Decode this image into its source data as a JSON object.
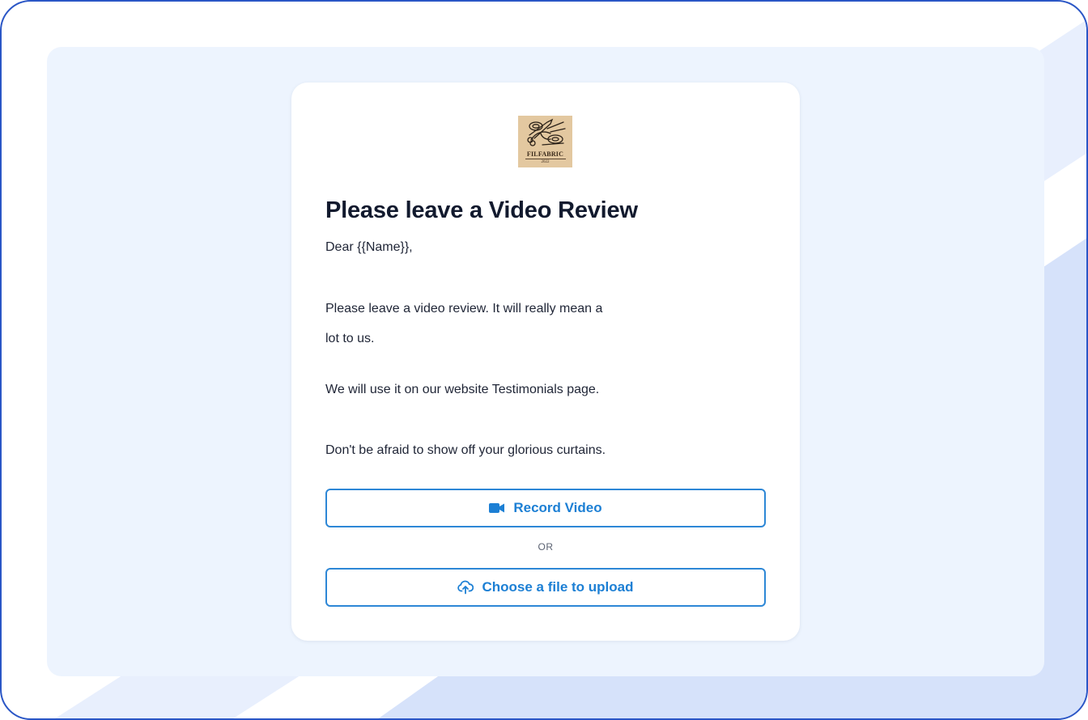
{
  "logo": {
    "name": "FILFABRIC",
    "year": "2022"
  },
  "form": {
    "title": "Please leave a Video Review",
    "greeting": "Dear {{Name}},",
    "paragraph_line_1": "Please leave a video review. It will really mean a",
    "paragraph_line_2": "lot to us.",
    "testimonials_note": "We will use it on our website Testimonials page.",
    "closing": "Don't be afraid to show off your glorious curtains."
  },
  "actions": {
    "record_label": "Record Video",
    "record_icon": "video-camera-icon",
    "separator": "OR",
    "upload_label": "Choose a file to upload",
    "upload_icon": "cloud-upload-icon"
  },
  "colors": {
    "accent": "#1c7fd4",
    "frame_border": "#2a56c6",
    "panel_background": "#edf4fe",
    "title_text": "#121a2e"
  }
}
